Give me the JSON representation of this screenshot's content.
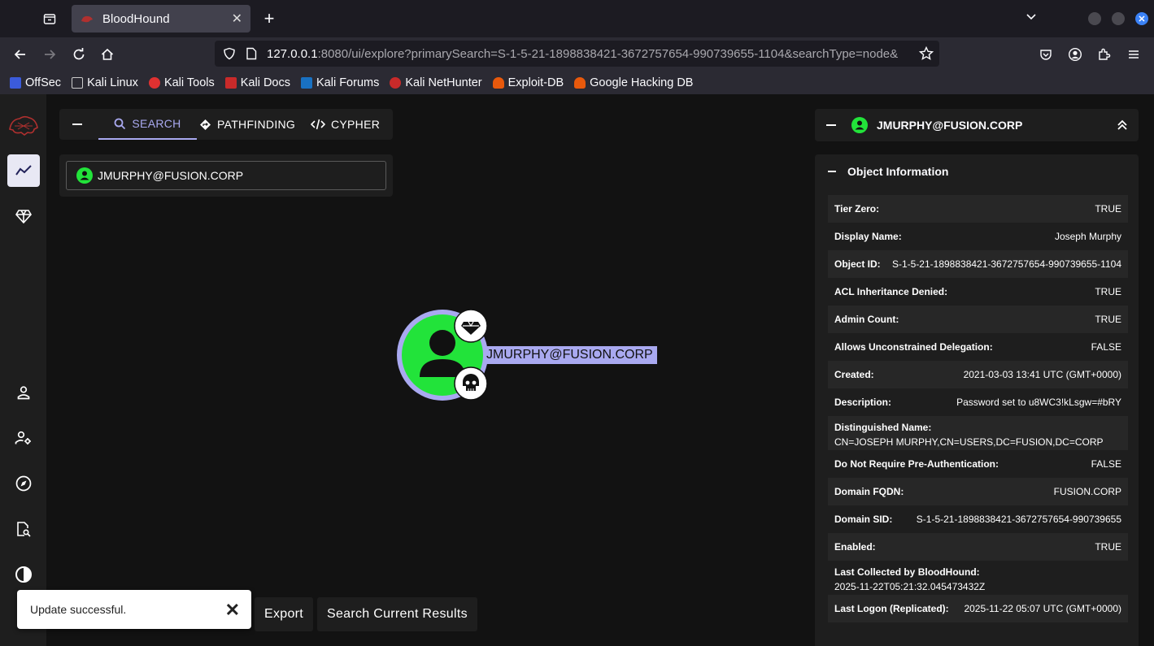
{
  "browser": {
    "tab_title": "BloodHound",
    "url_host": "127.0.0.1",
    "url_rest": ":8080/ui/explore?primarySearch=S-1-5-21-1898838421-3672757654-990739655-1104&searchType=node&",
    "bookmarks": [
      {
        "label": "OffSec",
        "color": "#3b5bdb"
      },
      {
        "label": "Kali Linux",
        "color": "#2b2a33"
      },
      {
        "label": "Kali Tools",
        "color": "#e03131"
      },
      {
        "label": "Kali Docs",
        "color": "#c92a2a"
      },
      {
        "label": "Kali Forums",
        "color": "#1971c2"
      },
      {
        "label": "Kali NetHunter",
        "color": "#c92a2a"
      },
      {
        "label": "Exploit-DB",
        "color": "#e8590c"
      },
      {
        "label": "Google Hacking DB",
        "color": "#e8590c"
      }
    ]
  },
  "search_panel": {
    "tabs": [
      {
        "label": "SEARCH",
        "icon": "search-icon"
      },
      {
        "label": "PATHFINDING",
        "icon": "pathfinding-icon"
      },
      {
        "label": "CYPHER",
        "icon": "code-icon"
      }
    ],
    "search_value": "JMURPHY@FUSION.CORP"
  },
  "graph": {
    "node_label": "JMURPHY@FUSION.CORP",
    "node_color": "#22e33a"
  },
  "toast": {
    "message": "Update successful."
  },
  "bottom_buttons": {
    "export": "Export",
    "search_results": "Search Current Results"
  },
  "entity_panel": {
    "title": "JMURPHY@FUSION.CORP",
    "section_title": "Object Information",
    "properties": [
      {
        "key": "Tier Zero:",
        "value": "TRUE"
      },
      {
        "key": "Display Name:",
        "value": "Joseph Murphy"
      },
      {
        "key": "Object ID:",
        "value": "S-1-5-21-1898838421-3672757654-990739655-1104"
      },
      {
        "key": "ACL Inheritance Denied:",
        "value": "TRUE"
      },
      {
        "key": "Admin Count:",
        "value": "TRUE"
      },
      {
        "key": "Allows Unconstrained Delegation:",
        "value": "FALSE"
      },
      {
        "key": "Created:",
        "value": "2021-03-03 13:41 UTC (GMT+0000)"
      },
      {
        "key": "Description:",
        "value": "Password set to u8WC3!kLsgw=#bRY"
      },
      {
        "key": "Distinguished Name:",
        "value": "CN=JOSEPH MURPHY,CN=USERS,DC=FUSION,DC=CORP"
      },
      {
        "key": "Do Not Require Pre-Authentication:",
        "value": "FALSE"
      },
      {
        "key": "Domain FQDN:",
        "value": "FUSION.CORP"
      },
      {
        "key": "Domain SID:",
        "value": "S-1-5-21-1898838421-3672757654-990739655"
      },
      {
        "key": "Enabled:",
        "value": "TRUE"
      },
      {
        "key": "Last Collected by BloodHound:",
        "value": "2025-11-22T05:21:32.045473432Z"
      },
      {
        "key": "Last Logon (Replicated):",
        "value": "2025-11-22 05:07 UTC (GMT+0000)"
      }
    ]
  }
}
